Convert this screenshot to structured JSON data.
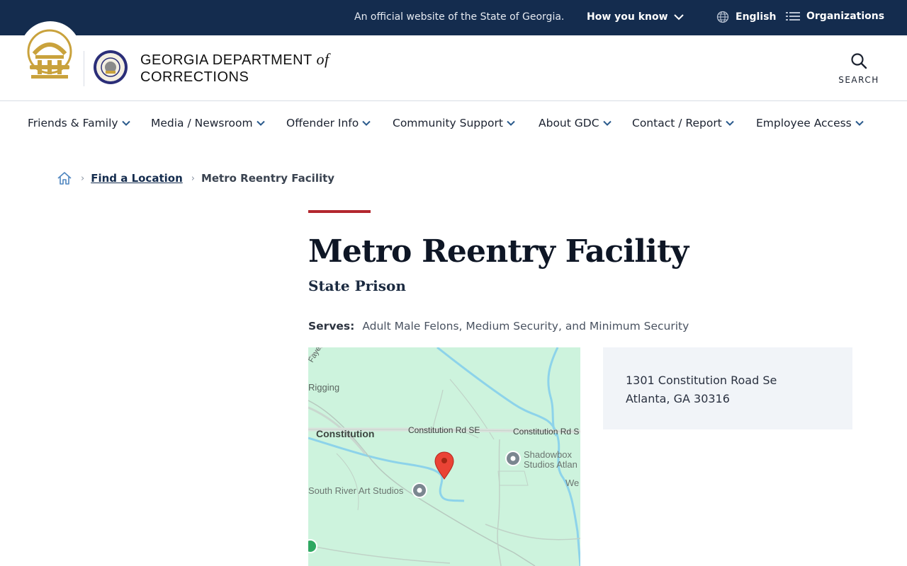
{
  "top_banner": {
    "official_text": "An official website of the State of Georgia.",
    "how_you_know": "How you know",
    "language": "English",
    "organizations": "Organizations"
  },
  "header": {
    "title_main": "GEORGIA DEPARTMENT",
    "title_of": "of",
    "title_line2": "CORRECTIONS",
    "search_label": "SEARCH"
  },
  "nav": {
    "items": [
      {
        "label": "Friends & Family"
      },
      {
        "label": "Media / Newsroom"
      },
      {
        "label": "Offender Info"
      },
      {
        "label": "Community Support"
      },
      {
        "label": "About GDC"
      },
      {
        "label": "Contact / Report"
      },
      {
        "label": "Employee Access"
      }
    ]
  },
  "breadcrumb": {
    "link": "Find a Location",
    "current": "Metro Reentry Facility"
  },
  "page": {
    "title": "Metro Reentry Facility",
    "subtitle": "State Prison",
    "serves_label": "Serves:",
    "serves_value": "Adult Male Felons, Medium Security, and Minimum Security"
  },
  "map": {
    "labels": {
      "fayette": "Fayet",
      "rigging": "Rigging",
      "constitution": "Constitution",
      "road1": "Constitution Rd SE",
      "road2": "Constitution Rd S",
      "shadowbox1": "Shadowbox",
      "shadowbox2": "Studios Atlan",
      "south_river": "South River Art Studios",
      "we": "We"
    }
  },
  "address": {
    "line1": "1301 Constitution Road Se",
    "line2": "Atlanta, GA 30316"
  },
  "colors": {
    "navy": "#142c4e",
    "accent_red": "#b3262e",
    "map_green": "#cdf3dd",
    "gold": "#c9a23c"
  }
}
